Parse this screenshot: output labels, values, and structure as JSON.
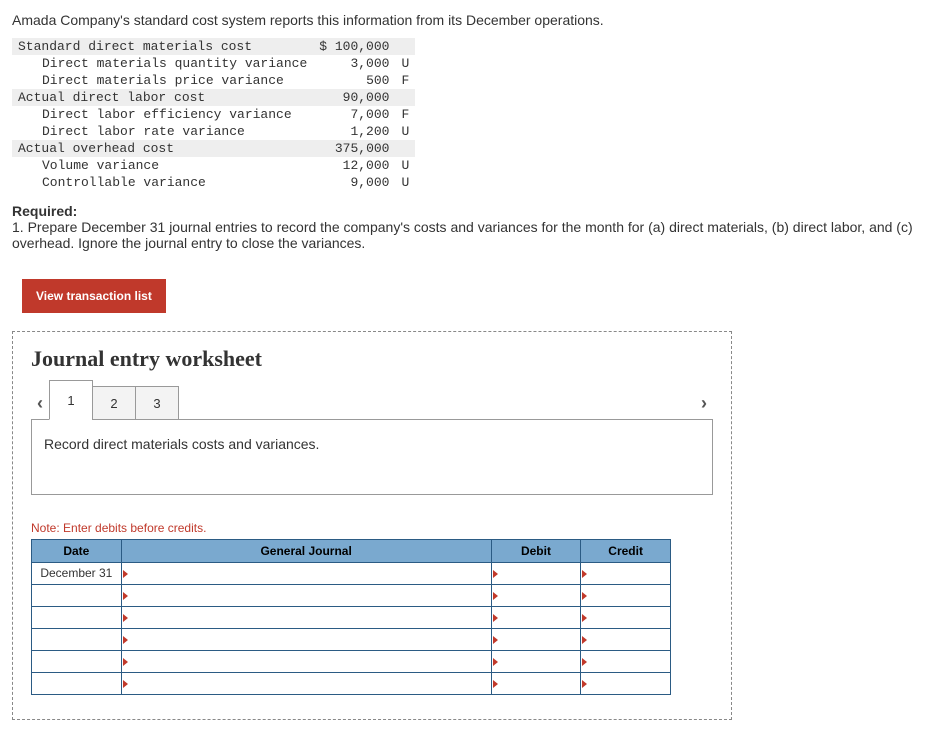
{
  "intro": "Amada Company's standard cost system reports this information from its December operations.",
  "costs": [
    {
      "label": "Standard direct materials cost",
      "value": "$ 100,000",
      "flag": "",
      "hl": true,
      "indent": false
    },
    {
      "label": "Direct materials quantity variance",
      "value": "3,000",
      "flag": "U",
      "hl": false,
      "indent": true
    },
    {
      "label": "Direct materials price variance",
      "value": "500",
      "flag": "F",
      "hl": false,
      "indent": true
    },
    {
      "label": "Actual direct labor cost",
      "value": "90,000",
      "flag": "",
      "hl": true,
      "indent": false
    },
    {
      "label": "Direct labor efficiency variance",
      "value": "7,000",
      "flag": "F",
      "hl": false,
      "indent": true
    },
    {
      "label": "Direct labor rate variance",
      "value": "1,200",
      "flag": "U",
      "hl": false,
      "indent": true
    },
    {
      "label": "Actual overhead cost",
      "value": "375,000",
      "flag": "",
      "hl": true,
      "indent": false
    },
    {
      "label": "Volume variance",
      "value": "12,000",
      "flag": "U",
      "hl": false,
      "indent": true
    },
    {
      "label": "Controllable variance",
      "value": "9,000",
      "flag": "U",
      "hl": false,
      "indent": true
    }
  ],
  "required_head": "Required:",
  "required_text": "1. Prepare December 31 journal entries to record the company's costs and variances for the month for (a) direct materials, (b) direct labor, and (c) overhead. Ignore the journal entry to close the variances.",
  "view_btn": "View transaction list",
  "ws_title": "Journal entry worksheet",
  "tabs": {
    "t1": "1",
    "t2": "2",
    "t3": "3"
  },
  "instruction": "Record direct materials costs and variances.",
  "note": "Note: Enter debits before credits.",
  "headers": {
    "date": "Date",
    "gj": "General Journal",
    "debit": "Debit",
    "credit": "Credit"
  },
  "first_date": "December 31"
}
